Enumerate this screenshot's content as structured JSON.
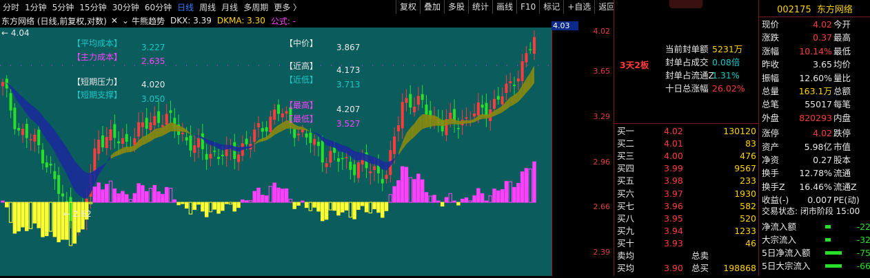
{
  "periods": [
    "分时",
    "1分钟",
    "5分钟",
    "15分钟",
    "30分钟",
    "60分钟",
    "日线",
    "周线",
    "月线",
    "多周期",
    "更多 〉"
  ],
  "active_period": "日线",
  "tools": [
    "复权",
    "叠加",
    "多股",
    "统计",
    "画线",
    "F10",
    "标记",
    "+自选",
    "返回"
  ],
  "title": {
    "name": "东方网络 (日线,前复权,对数)",
    "indicator": "牛熊趋势",
    "dkx": "DKX: 3.39",
    "dkma": "DKMA: 3.30",
    "formula": "公式: -"
  },
  "overlay": {
    "avg_cost_label": "【平均成本】",
    "avg_cost": "3.227",
    "main_cost_label": "【主力成本】",
    "main_cost": "2.635",
    "st_pressure_label": "【短期压力】",
    "st_pressure": "4.020",
    "st_support_label": "【短期支撑】",
    "st_support": "3.050",
    "mid_label": "【中价】",
    "mid": "3.867",
    "near_high_label": "【近高】",
    "near_high": "4.173",
    "near_low_label": "【近低】",
    "near_low": "3.713",
    "high_label": "【最高】",
    "high": "4.207",
    "low_label": "【最低】",
    "low": "3.527",
    "top_left_mark": "← 4.04",
    "bottom_mark": "← 2.62"
  },
  "price_axis": {
    "current_tag": "4.03",
    "labels": [
      "4.02",
      "3.65",
      "3.29",
      "2.96",
      "2.66",
      "2.39"
    ]
  },
  "limit_tag": "3天2板",
  "seal": [
    {
      "label": "当前封单额",
      "value": "5231万"
    },
    {
      "label": "封单占成交",
      "value": "0.08倍"
    },
    {
      "label": "封单占流通Z",
      "value": "1.31%"
    },
    {
      "label": "十日总涨幅",
      "value": "26.02%"
    }
  ],
  "book": {
    "buy_levels": [
      {
        "label": "买一",
        "price": "4.02",
        "vol": "130120"
      },
      {
        "label": "买二",
        "price": "4.01",
        "vol": "83"
      },
      {
        "label": "买三",
        "price": "4.00",
        "vol": "476"
      },
      {
        "label": "买四",
        "price": "3.99",
        "vol": "9567"
      },
      {
        "label": "买五",
        "price": "3.98",
        "vol": "233"
      },
      {
        "label": "买六",
        "price": "3.97",
        "vol": "1930"
      },
      {
        "label": "买七",
        "price": "3.96",
        "vol": "582"
      },
      {
        "label": "买八",
        "price": "3.95",
        "vol": "520"
      },
      {
        "label": "买九",
        "price": "3.94",
        "vol": "1233"
      },
      {
        "label": "买十",
        "price": "3.93",
        "vol": "46"
      }
    ],
    "sell_avg_label": "卖均",
    "sell_total_label": "总卖",
    "buy_avg_label": "买均",
    "buy_avg": "3.90",
    "buy_total_label": "总买",
    "buy_total": "198868"
  },
  "stock": {
    "code": "002175",
    "name": "东方网络"
  },
  "quote": [
    {
      "l": "现价",
      "v": "4.02",
      "r": "今开",
      "vc": "red"
    },
    {
      "l": "涨跌",
      "v": "0.37",
      "r": "最高",
      "vc": "red"
    },
    {
      "l": "涨幅",
      "v": "10.14%",
      "r": "最低",
      "vc": "red"
    },
    {
      "l": "昨收",
      "v": "3.65",
      "r": "均价",
      "vc": "wht"
    },
    {
      "l": "振幅",
      "v": "12.60%",
      "r": "量比",
      "vc": "wht"
    },
    {
      "l": "总量",
      "v": "163.1万",
      "r": "总额",
      "vc": "yel"
    },
    {
      "l": "总笔",
      "v": "55017",
      "r": "每笔",
      "vc": "wht"
    },
    {
      "l": "外盘",
      "v": "820293",
      "r": "内盘",
      "vc": "red"
    },
    {
      "l": "涨停",
      "v": "4.02",
      "r": "跌停",
      "vc": "red"
    },
    {
      "l": "资产",
      "v": "5.98亿",
      "r": "市值",
      "vc": "wht"
    },
    {
      "l": "净资",
      "v": "0.27",
      "r": "股本",
      "vc": "wht"
    },
    {
      "l": "换手",
      "v": "12.78%",
      "r": "流通",
      "vc": "wht"
    },
    {
      "l": "换手Z",
      "v": "16.46%",
      "r": "流通Z",
      "vc": "wht"
    },
    {
      "l": "收益(-)",
      "v": "0.007",
      "r": "PE(动)",
      "vc": "wht"
    }
  ],
  "trade_status": "交易状态: 闭市阶段 15:00",
  "flows": [
    {
      "l": "净流入额",
      "v": "-22"
    },
    {
      "l": "大宗流入",
      "v": "-32"
    },
    {
      "l": "5日净流入额",
      "v": "-75"
    },
    {
      "l": "5日大宗流入",
      "v": "-66"
    }
  ],
  "colors": {
    "bg": "#000000",
    "chart_bg": "#0b5d5d",
    "up": "#ff3b3b",
    "down": "#28e028",
    "macd_pos": "#ff40ff",
    "macd_neg": "#ffff33",
    "trend_up": "#8a8a10",
    "trend_down": "#1a2a9a"
  }
}
